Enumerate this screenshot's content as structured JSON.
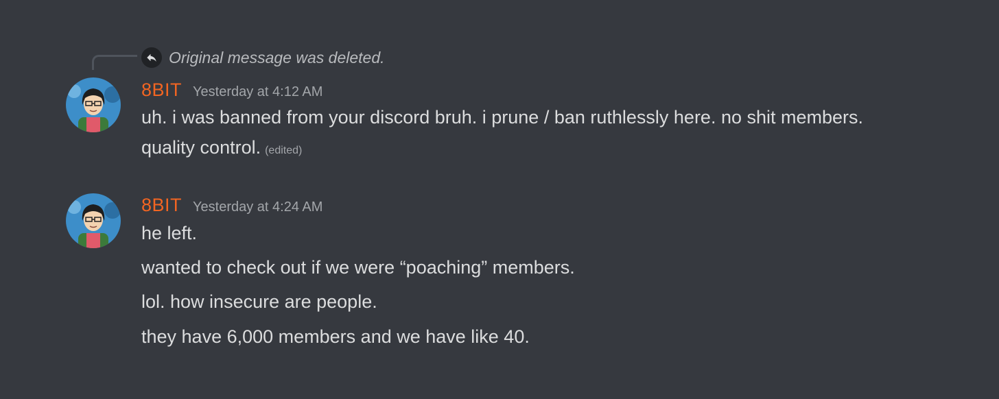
{
  "reply": {
    "text": "Original message was deleted.",
    "icon": "reply-arrow-icon"
  },
  "messages": [
    {
      "username": "8BIT",
      "timestamp": "Yesterday at 4:12 AM",
      "lines": [
        "uh. i was banned from your discord bruh. i prune / ban ruthlessly here. no shit members.",
        "quality control."
      ],
      "edited": "(edited)"
    },
    {
      "username": "8BIT",
      "timestamp": "Yesterday at 4:24 AM",
      "lines": [
        "he left.",
        "wanted to check out if we were “poaching” members.",
        "lol. how insecure are people.",
        "they have 6,000 members and we have like 40."
      ]
    }
  ],
  "colors": {
    "background": "#36393f",
    "username": "#f26522",
    "timestamp": "#a3a6aa",
    "text": "#dcddde"
  }
}
